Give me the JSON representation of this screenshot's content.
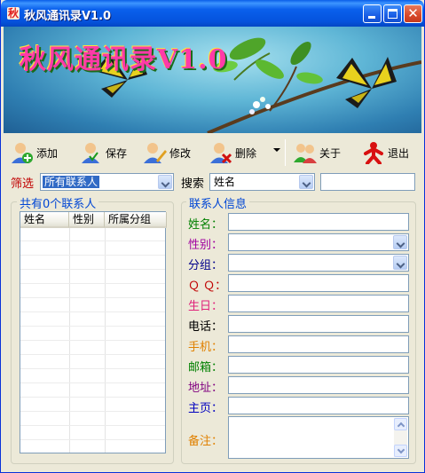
{
  "window": {
    "title": "秋风通讯录V1.0",
    "app_icon_glyph": "秋"
  },
  "banner": {
    "title": "秋风通讯录V1.0"
  },
  "toolbar": {
    "add_label": "添加",
    "save_label": "保存",
    "edit_label": "修改",
    "delete_label": "删除",
    "about_label": "关于",
    "exit_label": "退出"
  },
  "filter": {
    "label": "筛选",
    "value": "所有联系人",
    "search_label": "搜索",
    "search_field_value": "姓名",
    "search_text": ""
  },
  "contacts_group": {
    "title": "共有0个联系人",
    "columns": [
      "姓名",
      "性别",
      "所属分组"
    ]
  },
  "info_group": {
    "title": "联系人信息",
    "fields": [
      {
        "label": "姓名：",
        "color": "#008000"
      },
      {
        "label": "性别：",
        "color": "#a000a0"
      },
      {
        "label": "分组：",
        "color": "#00008b"
      },
      {
        "label": "Ｑ Ｑ：",
        "color": "#c00000"
      },
      {
        "label": "生日：",
        "color": "#e0207a"
      },
      {
        "label": "电话：",
        "color": "#000000"
      },
      {
        "label": "手机：",
        "color": "#e08000"
      },
      {
        "label": "邮箱：",
        "color": "#008000"
      },
      {
        "label": "地址：",
        "color": "#800080"
      },
      {
        "label": "主页：",
        "color": "#0000c0"
      },
      {
        "label": "备注：",
        "color": "#e08000"
      }
    ]
  },
  "colors": {
    "title_bar": "#0a60ec",
    "filter_label": "#c00000",
    "group_title": "#0046d5",
    "selection": "#316ac5"
  }
}
